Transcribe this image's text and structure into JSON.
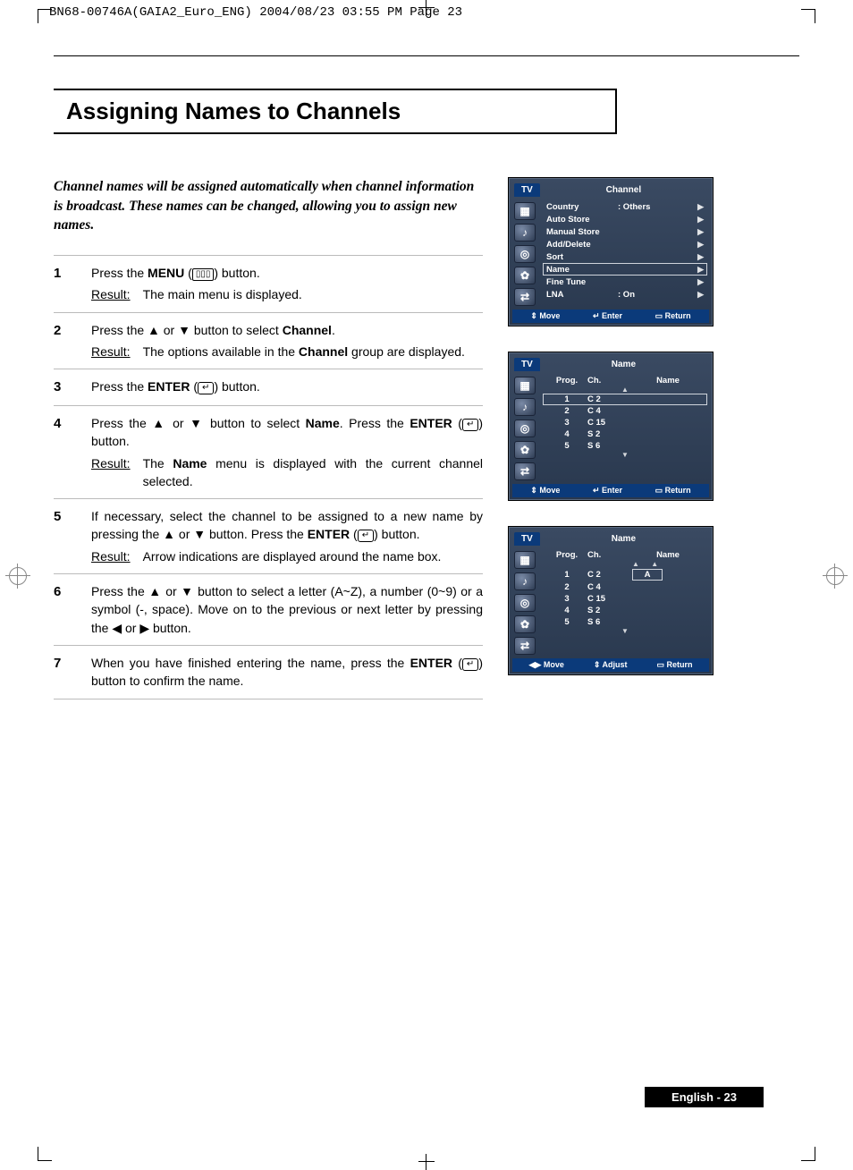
{
  "header": "BN68-00746A(GAIA2_Euro_ENG)  2004/08/23  03:55 PM  Page 23",
  "title": "Assigning Names to Channels",
  "intro": "Channel names will be assigned automatically when channel information is broadcast. These names can be changed, allowing you to assign new names.",
  "result_label": "Result:",
  "steps": [
    {
      "num": "1",
      "text_pre": "Press the ",
      "text_bold": "MENU",
      "text_post": " ( ▭▯▯ ) button.",
      "result": "The main menu is displayed."
    },
    {
      "num": "2",
      "text": "Press the ▲ or ▼ button to select ",
      "text_bold": "Channel",
      "text_post": ".",
      "result_pre": "The options available in the ",
      "result_bold": "Channel",
      "result_post": " group are displayed."
    },
    {
      "num": "3",
      "text_pre": "Press the ",
      "text_bold": "ENTER",
      "text_post": " ( ↵ ) button."
    },
    {
      "num": "4",
      "text": "Press the ▲ or ▼ button to select ",
      "text_bold1": "Name",
      "text_mid": ". Press the ",
      "text_bold2": "ENTER",
      "text_post": " ( ↵ ) button.",
      "result_pre": "The ",
      "result_bold": "Name",
      "result_post": " menu is displayed with the current channel selected."
    },
    {
      "num": "5",
      "text_pre": "If necessary, select the channel to be assigned to a new name by pressing the ▲ or ▼ button. Press the ",
      "text_bold": "ENTER",
      "text_post": " ( ↵ ) button.",
      "result": "Arrow indications are displayed around the name box."
    },
    {
      "num": "6",
      "text": "Press the ▲ or ▼ button to select a letter (A~Z), a number (0~9) or a symbol (-, space). Move on to the previous or next letter by pressing the ◀ or ▶ button."
    },
    {
      "num": "7",
      "text_pre": "When you have finished entering the name, press the ",
      "text_bold": "ENTER",
      "text_post": " ( ↵ ) button to confirm the name."
    }
  ],
  "osd1": {
    "tab": "TV",
    "title": "Channel",
    "rows": [
      {
        "k": "Country",
        "v": ": Others"
      },
      {
        "k": "Auto Store",
        "v": ""
      },
      {
        "k": "Manual Store",
        "v": ""
      },
      {
        "k": "Add/Delete",
        "v": ""
      },
      {
        "k": "Sort",
        "v": ""
      },
      {
        "k": "Name",
        "v": "",
        "sel": true
      },
      {
        "k": "Fine Tune",
        "v": ""
      },
      {
        "k": "LNA",
        "v": ": On"
      }
    ],
    "footer": [
      "⇕ Move",
      "↵ Enter",
      "▭ Return"
    ]
  },
  "osd2": {
    "tab": "TV",
    "title": "Name",
    "head": {
      "c1": "Prog.",
      "c2": "Ch.",
      "c3": "Name"
    },
    "rows": [
      {
        "p": "1",
        "ch": "C  2",
        "nm": "",
        "sel": true
      },
      {
        "p": "2",
        "ch": "C  4",
        "nm": ""
      },
      {
        "p": "3",
        "ch": "C  15",
        "nm": ""
      },
      {
        "p": "4",
        "ch": "S  2",
        "nm": ""
      },
      {
        "p": "5",
        "ch": "S  6",
        "nm": ""
      }
    ],
    "footer": [
      "⇕ Move",
      "↵ Enter",
      "▭ Return"
    ]
  },
  "osd3": {
    "tab": "TV",
    "title": "Name",
    "head": {
      "c1": "Prog.",
      "c2": "Ch.",
      "c3": "Name"
    },
    "rows": [
      {
        "p": "1",
        "ch": "C  2",
        "nm": "A",
        "editing": true
      },
      {
        "p": "2",
        "ch": "C  4",
        "nm": ""
      },
      {
        "p": "3",
        "ch": "C  15",
        "nm": ""
      },
      {
        "p": "4",
        "ch": "S  2",
        "nm": ""
      },
      {
        "p": "5",
        "ch": "S  6",
        "nm": ""
      }
    ],
    "footer": [
      "◀▶ Move",
      "⇕ Adjust",
      "▭ Return"
    ]
  },
  "page_number": "English - 23"
}
